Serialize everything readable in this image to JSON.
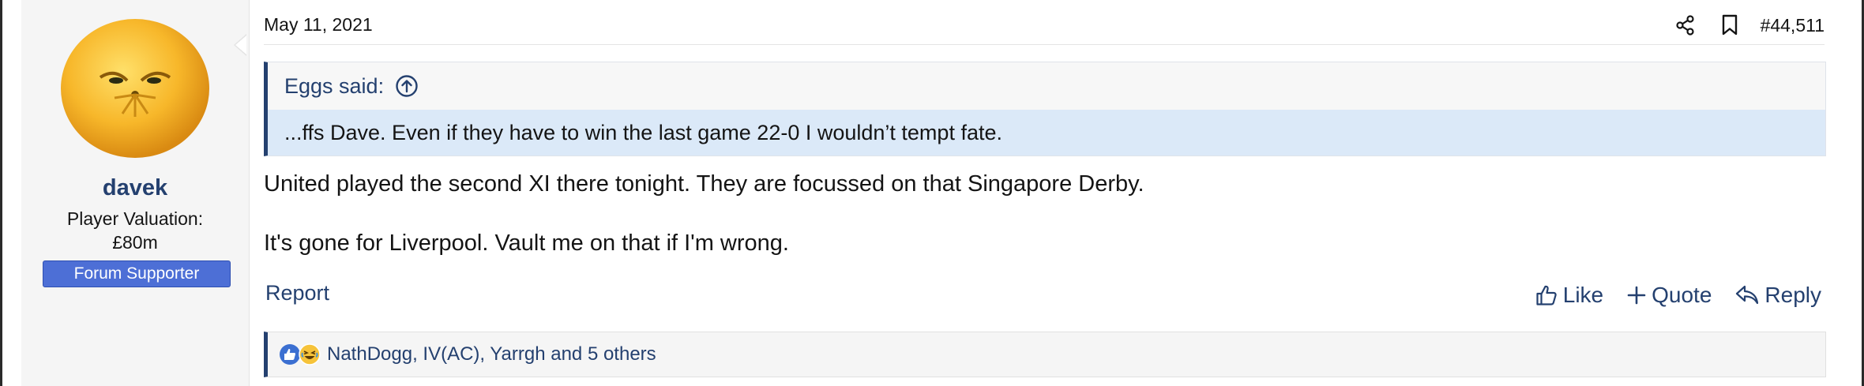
{
  "user": {
    "name": "davek",
    "valuation_label": "Player Valuation:",
    "valuation_value": "£80m",
    "badge": "Forum Supporter",
    "avatar_icon": "orange-face-avatar"
  },
  "post": {
    "date": "May 11, 2021",
    "number": "#44,511",
    "share_icon": "share-icon",
    "bookmark_icon": "bookmark-icon",
    "quote": {
      "author_label": "Eggs said:",
      "text": "...ffs Dave. Even if they have to win the last game 22-0 I wouldn’t tempt fate."
    },
    "body": [
      "United played the second XI there tonight. They are focussed on that Singapore Derby.",
      "It's gone for Liverpool. Vault me on that if I'm wrong."
    ]
  },
  "footer": {
    "report": "Report",
    "like": "Like",
    "quote": "Quote",
    "reply": "Reply"
  },
  "reactions": {
    "text": "NathDogg, IV(AC), Yarrgh and 5 others"
  },
  "colors": {
    "link": "#24406f",
    "badge_bg": "#4d6fd6",
    "quote_bg": "#dbe9f8"
  }
}
